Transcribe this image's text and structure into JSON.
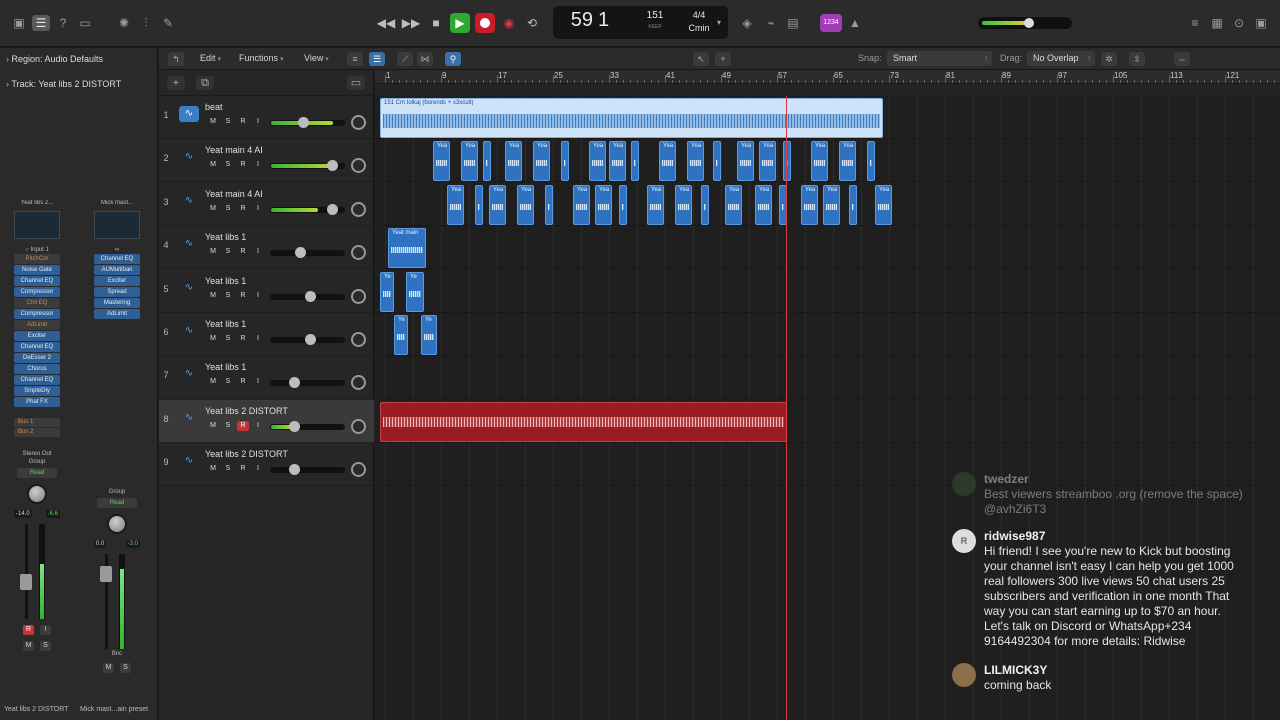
{
  "transport": {
    "bar": "59",
    "beat": "1",
    "tempo": "151",
    "tempo_mode": "KEEP",
    "time_signature": "4/4",
    "key": "Cmin",
    "count_in_label": "1234",
    "master_volume_fraction": 0.55
  },
  "inspector": {
    "region_label": "Region: Audio Defaults",
    "track_label": "Track: Yeat libs 2 DISTORT",
    "strip1": {
      "name": "Yeat libs 2...",
      "input": "Input 1",
      "plugins": [
        "PitchCor",
        "Noise Gate",
        "Channel EQ",
        "Compressor",
        "Chil EQ",
        "Compressor",
        "AdLimit",
        "Exciter",
        "Channel EQ",
        "DeEsser 2",
        "Chorus",
        "Channel EQ",
        "SmpleDly",
        "Phat FX"
      ],
      "plugins_off": [
        true,
        false,
        false,
        false,
        true,
        false,
        true,
        false,
        false,
        false,
        false,
        false,
        false,
        false
      ],
      "sends": [
        "Bus 1",
        "Bus 2"
      ],
      "output": "Stereo Out",
      "group": "Group",
      "automation": "Read",
      "db_left": "-14.0",
      "db_right": "-6.6",
      "bottom_name": "Yeat libs 2 DISTORT"
    },
    "strip2": {
      "name": "Mick mast...",
      "plugins": [
        "Channel EQ",
        "AUMultiban",
        "Exciter",
        "Spread",
        "Mastering",
        "AdLimit"
      ],
      "group": "Group",
      "automation": "Read",
      "db_left": "0.0",
      "db_right": "-3.0",
      "output": "Bnc",
      "bottom_name": "Mick mast...ain preset"
    }
  },
  "toolbar": {
    "edit": "Edit",
    "functions": "Functions",
    "view": "View",
    "snap_label": "Snap:",
    "snap_value": "Smart",
    "drag_label": "Drag:",
    "drag_value": "No Overlap"
  },
  "ruler": {
    "marks": [
      "1",
      "9",
      "17",
      "25",
      "33",
      "41",
      "49",
      "57",
      "65",
      "73",
      "81",
      "89",
      "97",
      "105",
      "113",
      "121"
    ]
  },
  "tracks": [
    {
      "num": "1",
      "name": "beat",
      "volume_fraction": 0.45,
      "meter_fraction": 0.85,
      "armed": false,
      "selected": false,
      "icon_active": true
    },
    {
      "num": "2",
      "name": "Yeat main 4 AI",
      "volume_fraction": 0.92,
      "meter_fraction": 0.85,
      "armed": false,
      "selected": false,
      "icon_active": false
    },
    {
      "num": "3",
      "name": "Yeat main 4 AI",
      "volume_fraction": 0.92,
      "meter_fraction": 0.65,
      "armed": false,
      "selected": false,
      "icon_active": false
    },
    {
      "num": "4",
      "name": "Yeat libs 1",
      "volume_fraction": 0.4,
      "meter_fraction": 0,
      "armed": false,
      "selected": false,
      "icon_active": false
    },
    {
      "num": "5",
      "name": "Yeat libs 1",
      "volume_fraction": 0.57,
      "meter_fraction": 0,
      "armed": false,
      "selected": false,
      "icon_active": false
    },
    {
      "num": "6",
      "name": "Yeat libs 1",
      "volume_fraction": 0.57,
      "meter_fraction": 0,
      "armed": false,
      "selected": false,
      "icon_active": false
    },
    {
      "num": "7",
      "name": "Yeat libs 1",
      "volume_fraction": 0.3,
      "meter_fraction": 0,
      "armed": false,
      "selected": false,
      "icon_active": false
    },
    {
      "num": "8",
      "name": "Yeat libs 2 DISTORT",
      "volume_fraction": 0.3,
      "meter_fraction": 0.3,
      "armed": true,
      "selected": true,
      "icon_active": false
    },
    {
      "num": "9",
      "name": "Yeat libs 2 DISTORT",
      "volume_fraction": 0.3,
      "meter_fraction": 0,
      "armed": false,
      "selected": false,
      "icon_active": false
    }
  ],
  "regions": {
    "beat_name": "151 Cm tolkaj (borends + s3xcult)",
    "main_clip_label": "Yea",
    "main_clip_label_long": "Yeat main",
    "libs_clip_label": "Ye"
  },
  "buttons": {
    "mute": "M",
    "solo": "S",
    "record": "R",
    "input": "I"
  },
  "chat": [
    {
      "user": "twedzer",
      "text": "Best viewers streamboo .org (remove the space) @avhZi6T3",
      "avatar": ""
    },
    {
      "user": "ridwise987",
      "text": "Hi friend! I see you're new to Kick but boosting your channel isn't easy I can help you get 1000 real followers 300 live views 50 chat users 25 subscribers and verification in one month That way you can start earning up to $70 an hour. Let's talk on Discord or WhatsApp+234 9164492304 for more details: Ridwise",
      "avatar": "R"
    },
    {
      "user": "LILMICK3Y",
      "text": "coming back",
      "avatar": ""
    }
  ]
}
